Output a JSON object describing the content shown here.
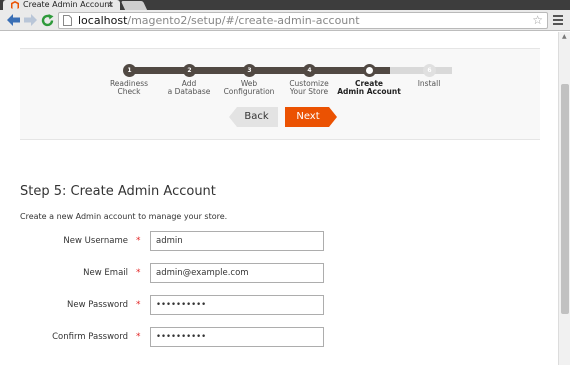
{
  "browser": {
    "tab_title": "Create Admin Account",
    "tab_close": "×",
    "url_host": "localhost",
    "url_path": "/magento2/setup/#/create-admin-account",
    "star": "☆"
  },
  "colors": {
    "accent": "#eb5202",
    "dark": "#514943",
    "required": "#e22626"
  },
  "steps": [
    {
      "number": "1",
      "line1": "Readiness",
      "line2": "Check",
      "state": "done"
    },
    {
      "number": "2",
      "line1": "Add",
      "line2": "a Database",
      "state": "done"
    },
    {
      "number": "3",
      "line1": "Web",
      "line2": "Configuration",
      "state": "done"
    },
    {
      "number": "4",
      "line1": "Customize",
      "line2": "Your Store",
      "state": "done"
    },
    {
      "number": "5",
      "line1": "Create",
      "line2": "Admin Account",
      "state": "current"
    },
    {
      "number": "6",
      "line1": "Install",
      "line2": "",
      "state": "todo"
    }
  ],
  "nav": {
    "back_label": "Back",
    "next_label": "Next"
  },
  "form": {
    "title": "Step 5: Create Admin Account",
    "description": "Create a new Admin account to manage your store.",
    "required_marker": "*",
    "fields": [
      {
        "label": "New Username",
        "value": "admin"
      },
      {
        "label": "New Email",
        "value": "admin@example.com"
      },
      {
        "label": "New Password",
        "value": "••••••••••"
      },
      {
        "label": "Confirm Password",
        "value": "••••••••••"
      }
    ]
  }
}
